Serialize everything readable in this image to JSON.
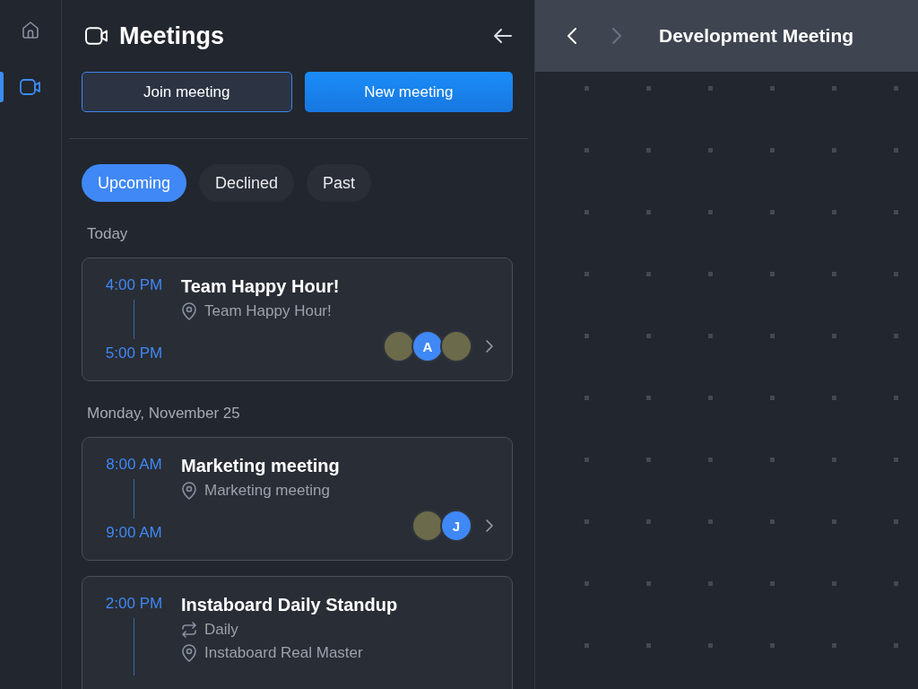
{
  "nav": [
    {
      "kind": "home",
      "selected": false
    },
    {
      "kind": "video",
      "selected": true
    }
  ],
  "panel": {
    "title": "Meetings",
    "buttons": [
      {
        "label": "Join meeting",
        "kind": "secondary"
      },
      {
        "label": "New meeting",
        "kind": "primary"
      }
    ]
  },
  "tabs": [
    {
      "label": "Upcoming",
      "selected": true
    },
    {
      "label": "Declined",
      "selected": false
    },
    {
      "label": "Past",
      "selected": false
    }
  ],
  "groups": [
    {
      "label": "Today",
      "meetings": [
        {
          "start": "4:00 PM",
          "end": "5:00 PM",
          "title": "Team Happy Hour!",
          "details": [
            {
              "kind": "location",
              "text": "Team Happy Hour!"
            }
          ],
          "attendees": [
            {
              "kind": "photo"
            },
            {
              "kind": "letter",
              "initial": "A"
            },
            {
              "kind": "photo"
            }
          ]
        }
      ]
    },
    {
      "label": "Monday, November 25",
      "meetings": [
        {
          "start": "8:00 AM",
          "end": "9:00 AM",
          "title": "Marketing meeting",
          "details": [
            {
              "kind": "location",
              "text": "Marketing meeting"
            }
          ],
          "attendees": [
            {
              "kind": "photo"
            },
            {
              "kind": "letter",
              "initial": "J"
            }
          ]
        },
        {
          "start": "2:00 PM",
          "title": "Instaboard Daily Standup",
          "details": [
            {
              "kind": "repeat",
              "text": "Daily"
            },
            {
              "kind": "location",
              "text": "Instaboard Real Master"
            }
          ]
        }
      ]
    }
  ],
  "board": {
    "title": "Development Meeting",
    "back_disabled": false,
    "forward_disabled": true
  }
}
